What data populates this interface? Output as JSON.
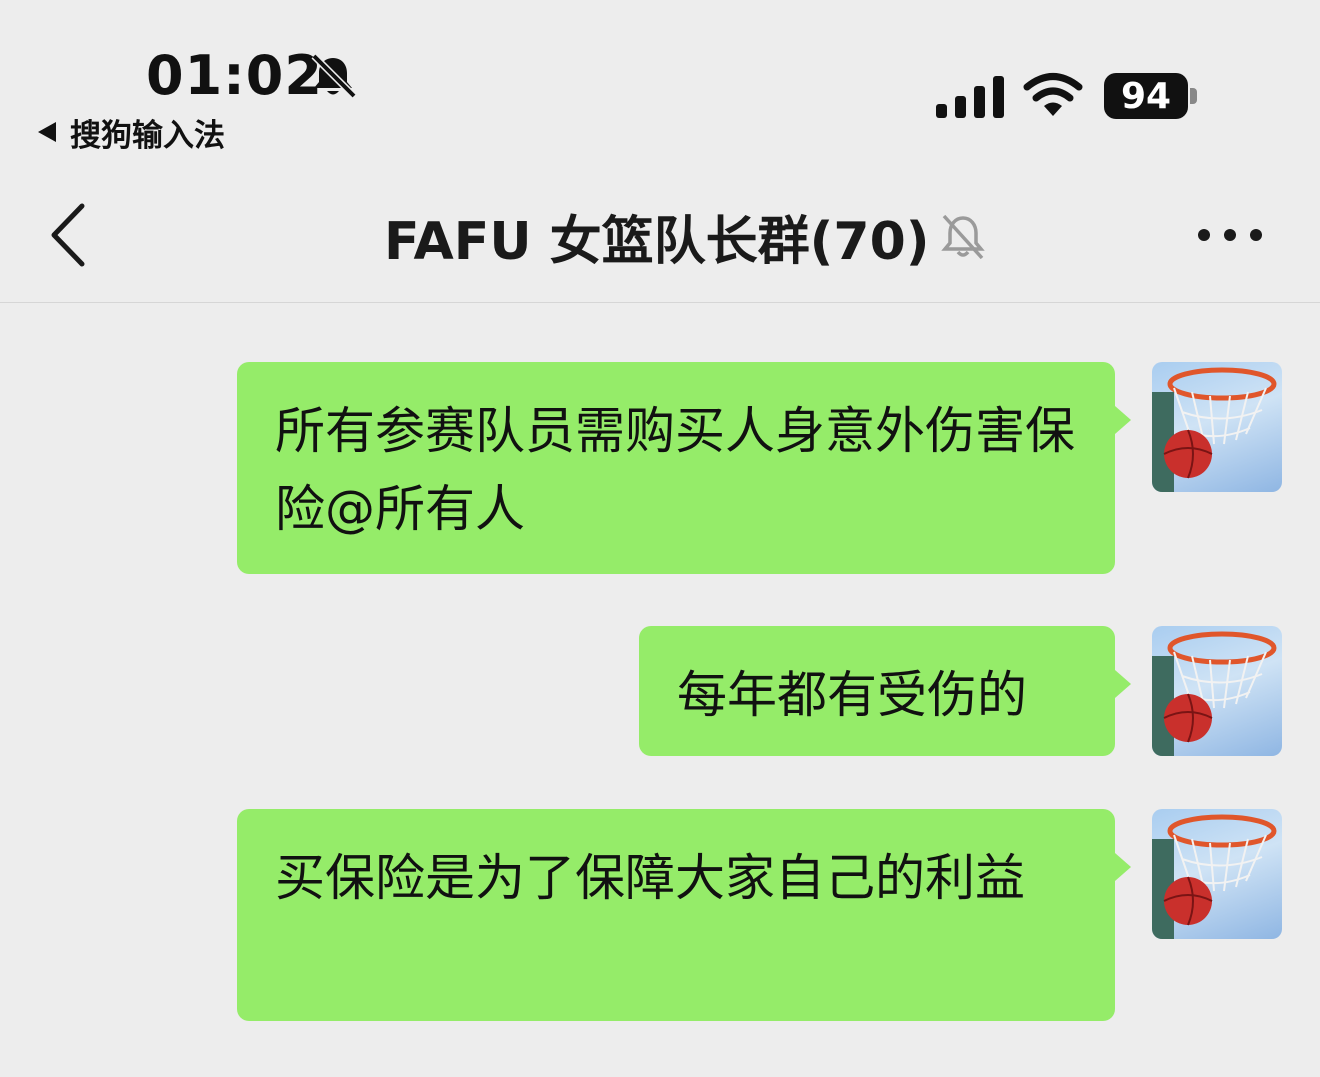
{
  "status_bar": {
    "time": "01:02",
    "back_app": "搜狗输入法",
    "battery": "94"
  },
  "nav": {
    "title": "FAFU 女篮队长群(70)",
    "icons": [
      "chevron-left-icon",
      "mute-bell-icon",
      "more-icon"
    ]
  },
  "messages": [
    {
      "text": "所有参赛队员需购买人身意外伤害保险@所有人",
      "sender": "self"
    },
    {
      "text": "每年都有受伤的",
      "sender": "self"
    },
    {
      "text": "买保险是为了保障大家自己的利益",
      "sender": "self"
    }
  ],
  "colors": {
    "background": "#ededed",
    "bubble_self": "#95ec69",
    "text": "#111111"
  }
}
